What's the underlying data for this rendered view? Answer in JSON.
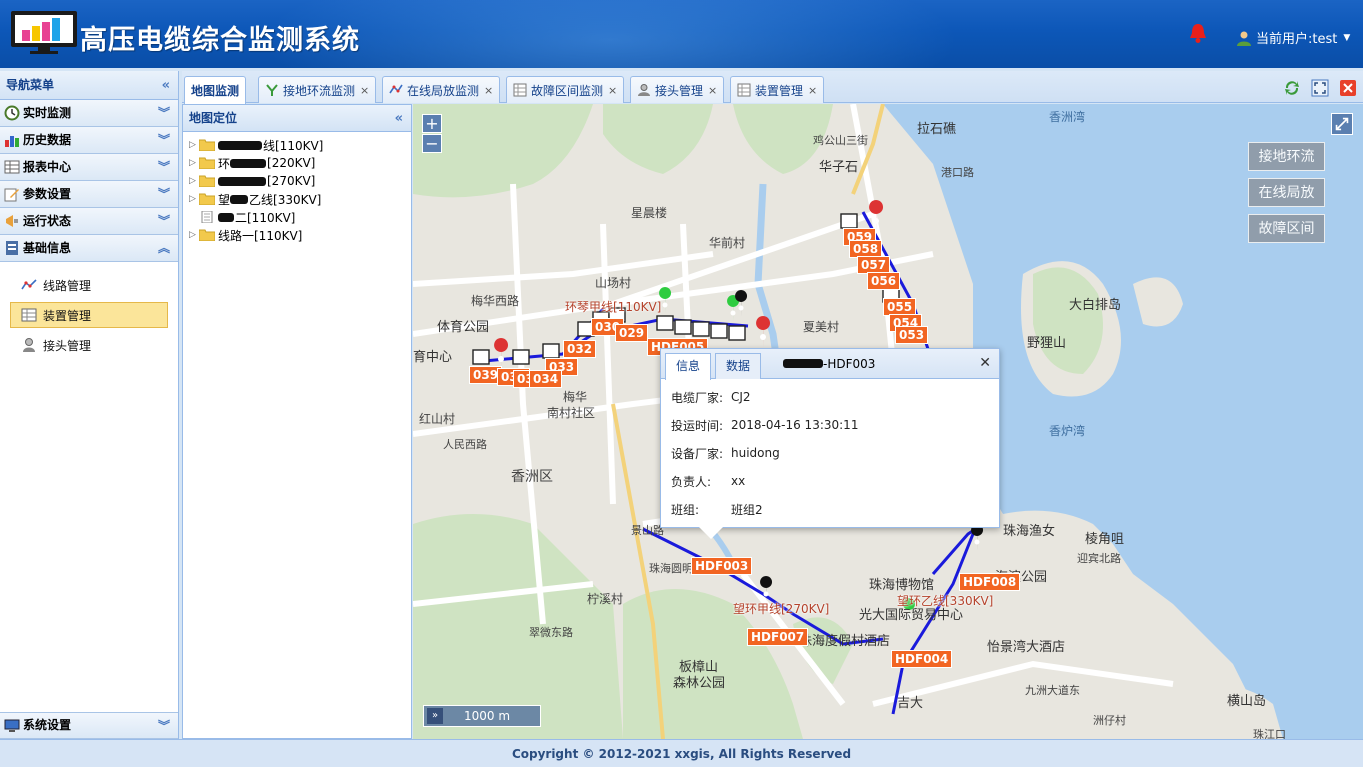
{
  "header": {
    "title": "高压电缆综合监测系统",
    "user_label": "当前用户:test"
  },
  "sidebar": {
    "title": "导航菜单",
    "menus": [
      {
        "label": "实时监测",
        "icon": "clock-icon"
      },
      {
        "label": "历史数据",
        "icon": "bar-chart-icon"
      },
      {
        "label": "报表中心",
        "icon": "table-icon"
      },
      {
        "label": "参数设置",
        "icon": "edit-icon"
      },
      {
        "label": "运行状态",
        "icon": "megaphone-icon"
      },
      {
        "label": "基础信息",
        "icon": "info-doc-icon"
      }
    ],
    "sub_items": [
      {
        "label": "线路管理",
        "icon": "route-icon"
      },
      {
        "label": "装置管理",
        "icon": "device-icon"
      },
      {
        "label": "接头管理",
        "icon": "person-icon"
      }
    ],
    "system_menu": "系统设置"
  },
  "tabs": [
    {
      "label": "地图监测",
      "active": true,
      "closable": false
    },
    {
      "label": "接地环流监测",
      "closable": true
    },
    {
      "label": "在线局放监测",
      "closable": true
    },
    {
      "label": "故障区间监测",
      "closable": true
    },
    {
      "label": "接头管理",
      "closable": true
    },
    {
      "label": "装置管理",
      "closable": true
    }
  ],
  "tree": {
    "title": "地图定位",
    "nodes": [
      {
        "visible_text": "线[110KV]",
        "type": "folder",
        "expandable": true
      },
      {
        "visible_text": "环",
        "suffix": "[220KV]",
        "type": "folder",
        "expandable": true
      },
      {
        "visible_text": "[270KV]",
        "type": "folder",
        "expandable": true
      },
      {
        "visible_text": "望",
        "suffix": "乙线[330KV]",
        "type": "folder",
        "expandable": true
      },
      {
        "visible_text": "二[110KV]",
        "type": "doc",
        "expandable": false
      },
      {
        "visible_text": "线路一[110KV]",
        "type": "folder",
        "expandable": true
      }
    ]
  },
  "map": {
    "buttons": [
      "接地环流",
      "在线局放",
      "故障区间"
    ],
    "zoom_in": "+",
    "zoom_out": "−",
    "scale_label": "1000 m",
    "places": [
      {
        "text": "拉石礁"
      },
      {
        "text": "香洲湾",
        "sea": true
      },
      {
        "text": "鸡公山三街"
      },
      {
        "text": "华子石"
      },
      {
        "text": "港口路"
      },
      {
        "text": "星晨楼"
      },
      {
        "text": "华前村"
      },
      {
        "text": "山场村"
      },
      {
        "text": "梅华西路"
      },
      {
        "text": "体育公园"
      },
      {
        "text": "夏美村"
      },
      {
        "text": "大白排岛"
      },
      {
        "text": "野狸山"
      },
      {
        "text": "育中心"
      },
      {
        "text": "梅华"
      },
      {
        "text": "南村社区"
      },
      {
        "text": "红山村"
      },
      {
        "text": "人民西路"
      },
      {
        "text": "香洲区"
      },
      {
        "text": "香炉湾",
        "sea": true
      },
      {
        "text": "珠海渔女"
      },
      {
        "text": "棱角咀"
      },
      {
        "text": "海滨公园"
      },
      {
        "text": "珠海博物馆"
      },
      {
        "text": "光大国际贸易中心"
      },
      {
        "text": "柠溪村"
      },
      {
        "text": "翠微东路"
      },
      {
        "text": "珠海圆明新园"
      },
      {
        "text": "珠海度假村酒店"
      },
      {
        "text": "怡景湾大酒店"
      },
      {
        "text": "板樟山"
      },
      {
        "text": "森林公园"
      },
      {
        "text": "吉大"
      },
      {
        "text": "横山岛"
      },
      {
        "text": "九洲大道东"
      },
      {
        "text": "洲仔村"
      },
      {
        "text": "珠江口"
      },
      {
        "text": "迎宾北路"
      },
      {
        "text": "景山路"
      }
    ],
    "line_labels": [
      "环琴甲线[110KV]",
      "望环甲线[270KV]",
      "望环乙线[330KV]"
    ],
    "unit_labels": [
      "059",
      "058",
      "057",
      "056",
      "055",
      "054",
      "053",
      "030",
      "029",
      "032",
      "033",
      "039",
      "037",
      "036",
      "034",
      "HDF005",
      "HDF003",
      "HDF007",
      "HDF008",
      "HDF004"
    ]
  },
  "popup": {
    "tabs": [
      "信息",
      "数据"
    ],
    "title_suffix": "-HDF003",
    "rows": [
      {
        "key": "电缆厂家:",
        "value": "CJ2"
      },
      {
        "key": "投运时间:",
        "value": "2018-04-16 13:30:11"
      },
      {
        "key": "设备厂家:",
        "value": "huidong"
      },
      {
        "key": "负责人:",
        "value": "xx"
      },
      {
        "key": "班组:",
        "value": "班组2"
      }
    ]
  },
  "footer": {
    "copyright": "Copyright © 2012-2021 xxgis, All Rights Reserved"
  },
  "colors": {
    "header": "#0d57b8",
    "cable_line": "#1a1adb",
    "unit_label": "#f26522",
    "active_menu": "#fbe59a"
  }
}
